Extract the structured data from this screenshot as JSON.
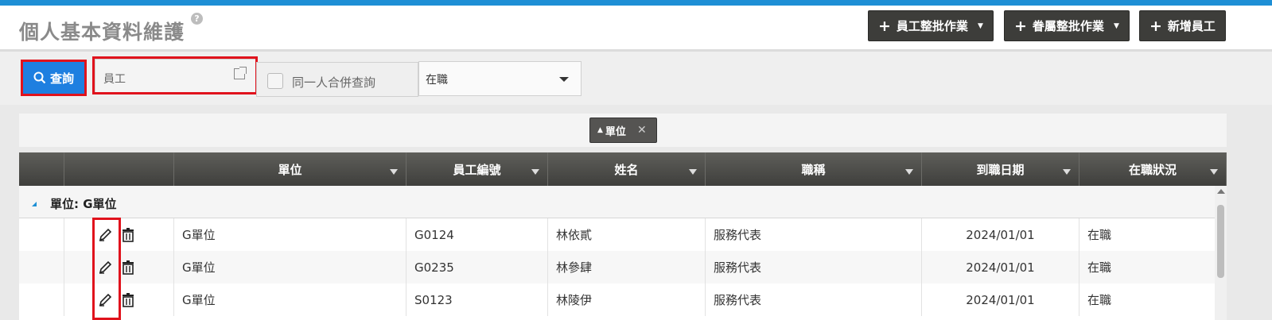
{
  "page": {
    "title": "個人基本資料維護",
    "help": "?"
  },
  "header_buttons": [
    {
      "label": "員工整批作業",
      "icon": "plus-icon",
      "dropdown": true
    },
    {
      "label": "眷屬整批作業",
      "icon": "plus-icon",
      "dropdown": true
    },
    {
      "label": "新增員工",
      "icon": "plus-icon",
      "dropdown": false
    }
  ],
  "toolbar": {
    "query_label": "查詢",
    "employee_field_value": "員工",
    "merge_label": "同一人合併查詢",
    "merge_checked": false,
    "status_value": "在職"
  },
  "grouping": {
    "chip_label": "單位"
  },
  "grid": {
    "columns": [
      "",
      "",
      "單位",
      "員工編號",
      "姓名",
      "職稱",
      "到職日期",
      "在職狀況"
    ],
    "group_label": "單位: G單位",
    "rows": [
      {
        "unit": "G單位",
        "emp_no": "G0124",
        "name": "林依貳",
        "title": "服務代表",
        "start_date": "2024/01/01",
        "status": "在職"
      },
      {
        "unit": "G單位",
        "emp_no": "G0235",
        "name": "林參肆",
        "title": "服務代表",
        "start_date": "2024/01/01",
        "status": "在職"
      },
      {
        "unit": "G單位",
        "emp_no": "S0123",
        "name": "林陵伊",
        "title": "服務代表",
        "start_date": "2024/01/01",
        "status": "在職"
      }
    ]
  },
  "colors": {
    "accent": "#1e8fd5",
    "query_button": "#1e7fe0",
    "highlight": "#e0121c",
    "header_dark": "#3d3d3a"
  }
}
